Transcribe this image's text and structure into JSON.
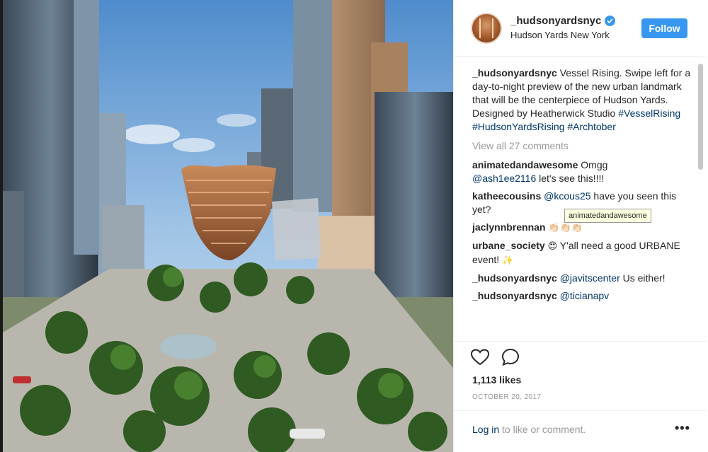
{
  "post": {
    "username": "_hudsonyardsnyc",
    "location": "Hudson Yards New York",
    "follow_label": "Follow",
    "photo_alt": "Rendering of the Vessel at Hudson Yards"
  },
  "caption": {
    "username": "_hudsonyardsnyc",
    "text": " Vessel Rising. Swipe left for a day-to-night preview of the new urban landmark that will be the centerpiece of Hudson Yards. Designed by Heatherwick Studio",
    "hashtags": [
      "#VesselRising",
      "#HudsonYardsRising",
      "#Archtober"
    ]
  },
  "view_all_comments": "View all 27 comments",
  "comments": [
    {
      "user": "animatedandawesome",
      "mention": "",
      "text": " Omgg "
    },
    {
      "user": "",
      "mention": "@ash1ee2116",
      "text": " let's see this!!!!"
    },
    {
      "user": "katheecousins",
      "mention": "@kcous25",
      "text": " have you seen this yet?"
    },
    {
      "user": "jaclynnbrennan",
      "mention": "",
      "text": " ",
      "emoji": "👏🏻👏🏻👏🏻"
    },
    {
      "user": "urbane_society",
      "mention": "",
      "text": " Y'all need a good URBANE event! ",
      "emoji": "😍"
    },
    {
      "user": "_hudsonyardsnyc",
      "mention": "@javitscenter",
      "text": " Us either!"
    },
    {
      "user": "_hudsonyardsnyc",
      "mention": "@ticianapv",
      "text": ""
    }
  ],
  "tooltip": "animatedandawesome",
  "likes": "1,113 likes",
  "date": "OCTOBER 20, 2017",
  "footer": {
    "login_link": "Log in",
    "login_rest": " to like or comment.",
    "more": "•••"
  },
  "icons": {
    "like": "heart-outline-icon",
    "comment": "speech-bubble-icon",
    "verified": "verified-badge-icon",
    "more": "ellipsis-icon"
  },
  "colors": {
    "accent": "#3897f0",
    "link": "#003569",
    "muted": "#999999",
    "text": "#262626"
  }
}
